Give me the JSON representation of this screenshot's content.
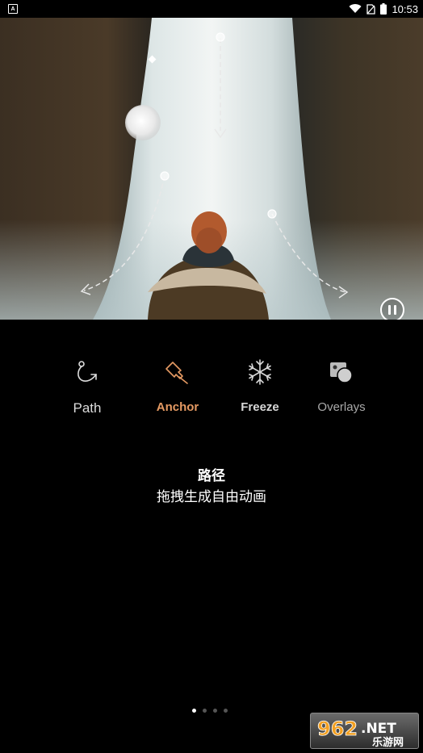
{
  "status_bar": {
    "notification_glyph": "A",
    "time": "10:53",
    "icons": [
      "wifi-icon",
      "no-sim-icon",
      "battery-icon"
    ]
  },
  "media": {
    "state": "playing",
    "control_icon": "pause-icon"
  },
  "tabs": [
    {
      "id": "path",
      "label": "Path",
      "icon": "path-icon",
      "selected": true
    },
    {
      "id": "anchor",
      "label": "Anchor",
      "icon": "anchor-pin-icon",
      "selected": false,
      "color": "#e59a63"
    },
    {
      "id": "freeze",
      "label": "Freeze",
      "icon": "snowflake-icon",
      "selected": false
    },
    {
      "id": "overlays",
      "label": "Overlays",
      "icon": "overlays-icon",
      "selected": false
    }
  ],
  "feature": {
    "title": "路径",
    "description": "拖拽生成自由动画"
  },
  "pager": {
    "count": 4,
    "active_index": 0
  },
  "watermark": {
    "text": "962.NET",
    "subtext": "乐游网"
  }
}
